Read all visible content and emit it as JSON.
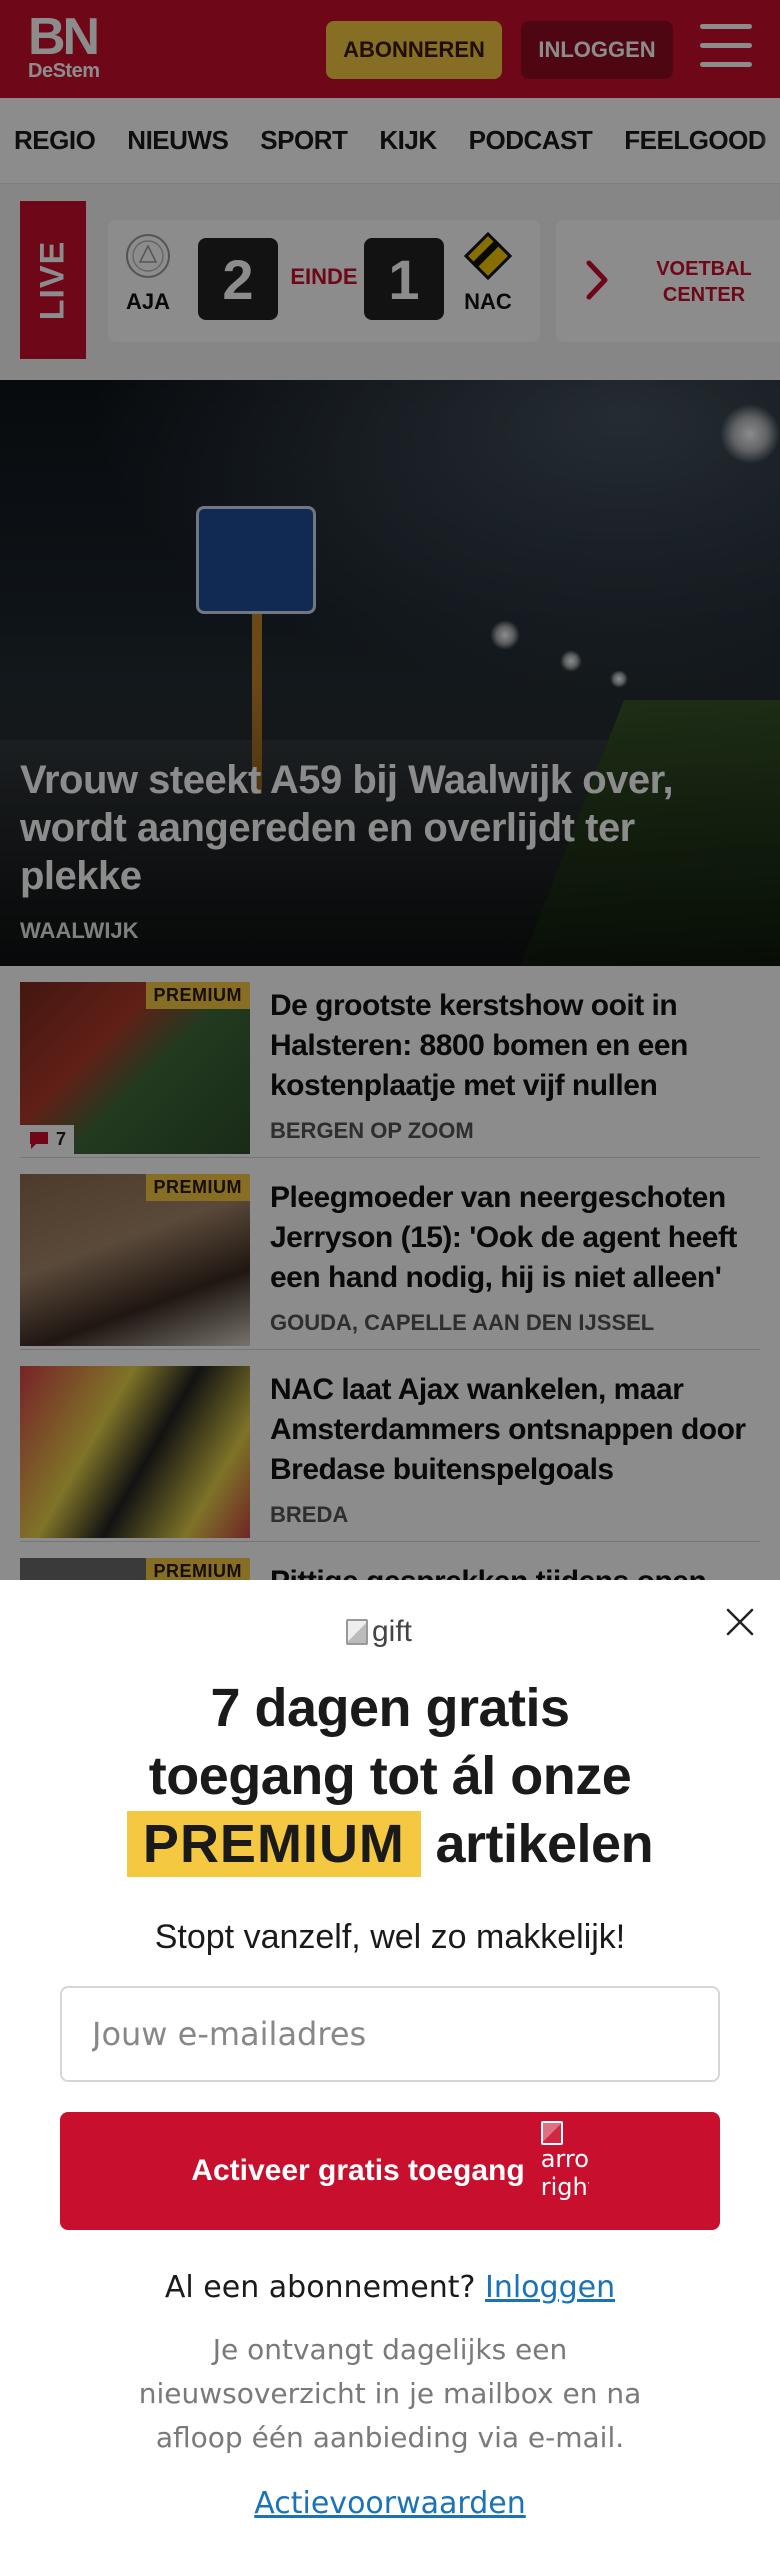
{
  "header": {
    "logo_main": "BN",
    "logo_sub": "DeStem",
    "subscribe_label": "ABONNEREN",
    "login_label": "INLOGGEN"
  },
  "nav": {
    "items": [
      "REGIO",
      "NIEUWS",
      "SPORT",
      "KIJK",
      "PODCAST",
      "FEELGOOD"
    ]
  },
  "live": {
    "tag": "LIVE",
    "home_team": "AJA",
    "home_score": "2",
    "status": "EINDE",
    "away_score": "1",
    "away_team": "NAC",
    "center_label_1": "VOETBAL",
    "center_label_2": "CENTER"
  },
  "hero": {
    "title": "Vrouw steekt A59 bij Waalwijk over, wordt aangereden en overlijdt ter plekke",
    "location": "WAALWIJK"
  },
  "articles": [
    {
      "title": "De grootste kerstshow ooit in Halsteren: 8800 bomen en een kostenplaatje met vijf nullen",
      "location": "BERGEN OP ZOOM",
      "badge": "PREMIUM",
      "comments": "7"
    },
    {
      "title": "Pleegmoeder van neergeschoten Jerryson (15): 'Ook de agent heeft een hand nodig, hij is niet alleen'",
      "location": "GOUDA, CAPELLE AAN DEN IJSSEL",
      "badge": "PREMIUM"
    },
    {
      "title": "NAC laat Ajax wankelen, maar Amsterdammers ontsnappen door Bredase buitenspelgoals",
      "location": "BREDA"
    },
    {
      "title": "Pittige gesprekken tijdens open",
      "badge": "PREMIUM"
    }
  ],
  "popup": {
    "gift_alt": "gift",
    "headline_1": "7 dagen gratis",
    "headline_2": "toegang tot ál onze",
    "premium_word": "PREMIUM",
    "headline_3": "artikelen",
    "subtitle": "Stopt vanzelf, wel zo makkelijk!",
    "email_placeholder": "Jouw e-mailadres",
    "cta_label": "Activeer gratis toegang",
    "cta_icon_alt": "arrow-right",
    "already_text": "Al een abonnement?",
    "login_link": "Inloggen",
    "fineprint": "Je ontvangt dagelijks een nieuwsoverzicht in je mailbox en na afloop één aanbieding via e-mail.",
    "terms_link": "Actievoorwaarden"
  },
  "colors": {
    "brand_red": "#c8102e",
    "premium_yellow": "#f5c842",
    "link_blue": "#1a73b8"
  }
}
